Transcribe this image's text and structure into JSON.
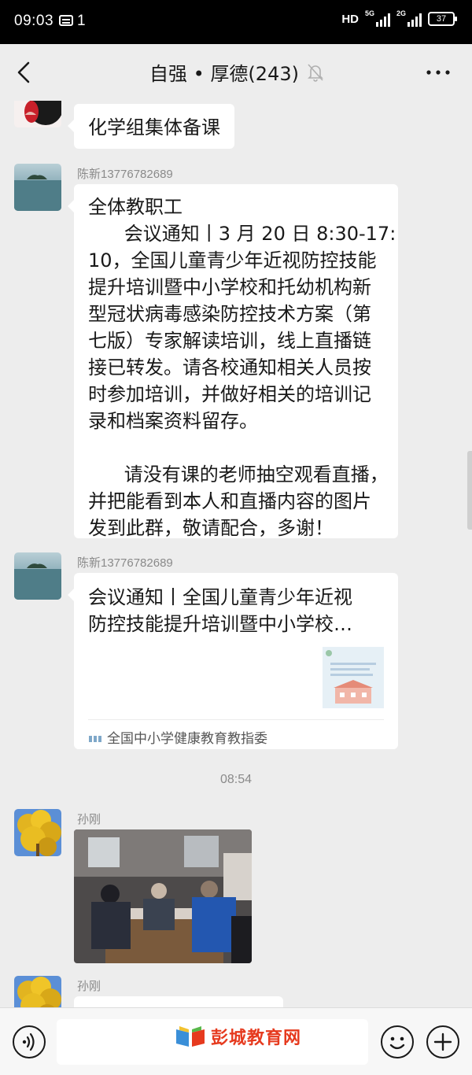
{
  "status_bar": {
    "time": "09:03",
    "notification_count": "1",
    "hd_label": "HD",
    "net1": "5G",
    "net2": "2G",
    "battery": "37"
  },
  "header": {
    "title": "自强 • 厚德(243)",
    "back_icon": "chevron-left-icon",
    "mute_icon": "bell-off-icon",
    "more_icon": "more-dots-icon"
  },
  "messages": [
    {
      "type": "text",
      "sender": "",
      "text": "化学组集体备课"
    },
    {
      "type": "text",
      "sender": "陈新13776782689",
      "lines": [
        "全体教职工",
        "      会议通知丨3 月 20 日 8:30-17:",
        "10，全国儿童青少年近视防控技能",
        "提升培训暨中小学校和托幼机构新",
        "型冠状病毒感染防控技术方案（第",
        "七版）专家解读培训，线上直播链",
        "接已转发。请各校通知相关人员按",
        "时参加培训，并做好相关的培训记",
        "录和档案资料留存。",
        "",
        "      请没有课的老师抽空观看直播，",
        "并把能看到本人和直播内容的图片",
        "发到此群，敬请配合，多谢！"
      ]
    },
    {
      "type": "card",
      "sender": "陈新13776782689",
      "title_lines": [
        "会议通知丨全国儿童青少年近视",
        "防控技能提升培训暨中小学校…"
      ],
      "source": "全国中小学健康教育教指委"
    },
    {
      "type": "timestamp",
      "text": "08:54"
    },
    {
      "type": "image",
      "sender": "孙刚"
    },
    {
      "type": "text",
      "sender": "孙刚"
    }
  ],
  "input_bar": {
    "voice_icon": "voice-icon",
    "emoji_icon": "emoji-icon",
    "plus_icon": "plus-icon",
    "watermark": "彭城教育网"
  }
}
